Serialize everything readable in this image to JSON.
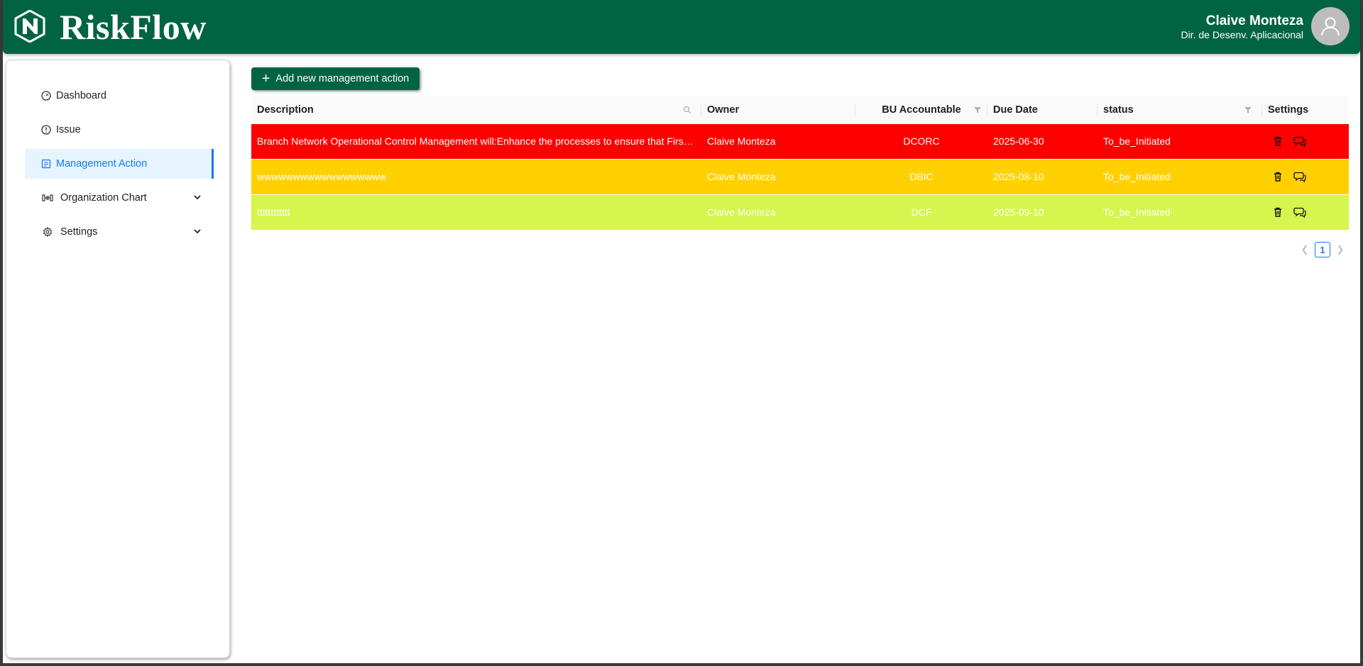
{
  "app": {
    "title": "RiskFlow",
    "brand_color": "#006443"
  },
  "user": {
    "name": "Claive Monteza",
    "role": "Dir. de Desenv. Aplicacional"
  },
  "sidebar": {
    "items": [
      {
        "label": "Dashboard",
        "icon": "dashboard-icon"
      },
      {
        "label": "Issue",
        "icon": "exclamation-circle-icon"
      },
      {
        "label": "Management Action",
        "icon": "form-icon",
        "active": true
      },
      {
        "label": "Organization Chart",
        "icon": "cluster-icon",
        "expandable": true
      },
      {
        "label": "Settings",
        "icon": "gear-icon",
        "expandable": true
      }
    ]
  },
  "toolbar": {
    "add_label": "Add new management action"
  },
  "table": {
    "columns": [
      "Description",
      "Owner",
      "BU Accountable",
      "Due Date",
      "status",
      "Settings"
    ],
    "rows": [
      {
        "description": "Branch Network Operational Control Management will:Enhance the processes to ensure that First ...",
        "owner": "Claive Monteza",
        "bu": "DCORC",
        "due": "2025-06-30",
        "status": "To_be_Initiated",
        "color": "#ff0000"
      },
      {
        "description": "wwwwwwwwwwwwwwwwww",
        "owner": "Claive Monteza",
        "bu": "DBIC",
        "due": "2025-08-10",
        "status": "To_be_Initiated",
        "color": "#ffd000"
      },
      {
        "description": "tttttttttttt",
        "owner": "Claive Monteza",
        "bu": "DCF",
        "due": "2025-09-10",
        "status": "To_be_Initiated",
        "color": "#d6f54e"
      }
    ]
  },
  "pagination": {
    "current": "1"
  }
}
